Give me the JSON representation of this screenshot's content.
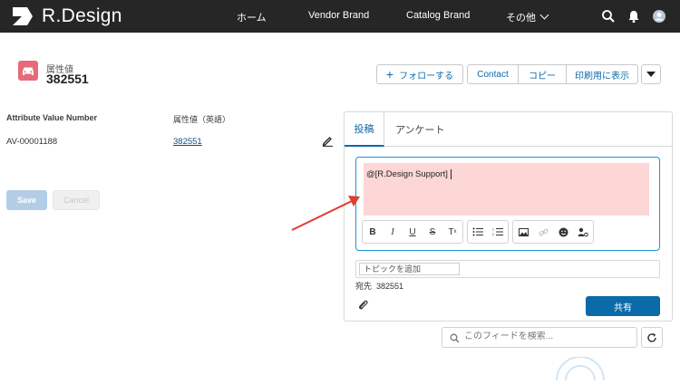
{
  "app": {
    "name": "R.Design"
  },
  "nav": {
    "items": [
      "ホーム",
      "Vendor Brand",
      "Catalog Brand",
      "その他"
    ]
  },
  "record": {
    "type_label": "属性値",
    "name": "382551",
    "actions": {
      "follow": "フォローする",
      "contact": "Contact",
      "copy": "コピー",
      "print": "印刷用に表示"
    }
  },
  "details": {
    "fields": [
      {
        "label": "Attribute Value Number",
        "value": "AV-00001188"
      },
      {
        "label": "属性値（英語）",
        "value": "382551"
      }
    ],
    "save_label": "Save",
    "cancel_label": "Cancel"
  },
  "publisher": {
    "tabs": [
      "投稿",
      "アンケート"
    ],
    "active_tab": "投稿",
    "composer_text": "@[R.Design Support]",
    "topic_placeholder": "トピックを追加",
    "to_label": "宛先",
    "to_value": "382551",
    "share_label": "共有",
    "highlight_color": "#fdd6d6"
  },
  "feed": {
    "search_placeholder": "このフィードを検索..."
  },
  "colors": {
    "topbar": "#262626",
    "accent": "#0b6aa8",
    "record_icon": "#e8697a",
    "arrow": "#e03c31"
  }
}
